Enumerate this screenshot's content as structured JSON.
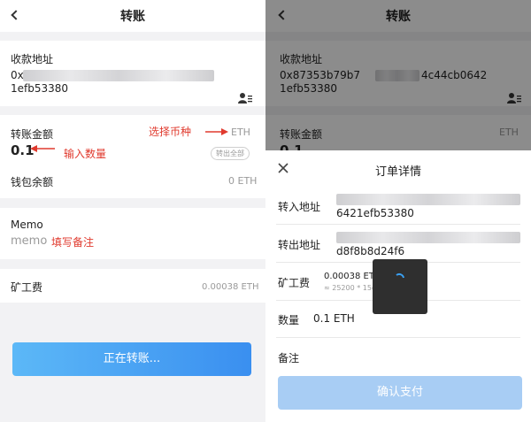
{
  "left": {
    "title": "转账",
    "address_label": "收款地址",
    "address_line1": "0x",
    "address_line2": "1efb53380",
    "amount_label": "转账金额",
    "amount_value": "0.1",
    "currency": "ETH",
    "transfer_all": "转出全部",
    "wallet_balance_label": "钱包余额",
    "wallet_balance_value": "0 ETH",
    "memo_label": "Memo",
    "memo_placeholder": "memo",
    "miner_fee_label": "矿工费",
    "miner_fee_value": "0.00038 ETH",
    "transfer_button": "正在转账...",
    "annotations": {
      "select_coin": "选择币种",
      "enter_amount": "输入数量",
      "fill_memo": "填写备注"
    }
  },
  "right": {
    "title": "转账",
    "address_label": "收款地址",
    "address_line1_start": "0x87353b79b7",
    "address_line1_end": "4c44cb0642",
    "address_line2": "1efb53380",
    "amount_label": "转账金额",
    "amount_value": "0.1",
    "currency": "ETH",
    "sheet": {
      "title": "订单详情",
      "to_label": "转入地址",
      "to_value_line2": "6421efb53380",
      "from_label": "转出地址",
      "from_value_line2": "d8f8b8d24f6",
      "fee_label": "矿工费",
      "fee_value": "0.00038 ETH",
      "fee_detail": "≈ 25200 * 15gwei",
      "qty_label": "数量",
      "qty_value": "0.1 ETH",
      "memo_label": "备注",
      "confirm_button": "确认支付"
    }
  },
  "colors": {
    "accent_blue": "#3aa0f2",
    "confirm_blue": "#a8cdf4",
    "annotation_red": "#e03a2e"
  }
}
